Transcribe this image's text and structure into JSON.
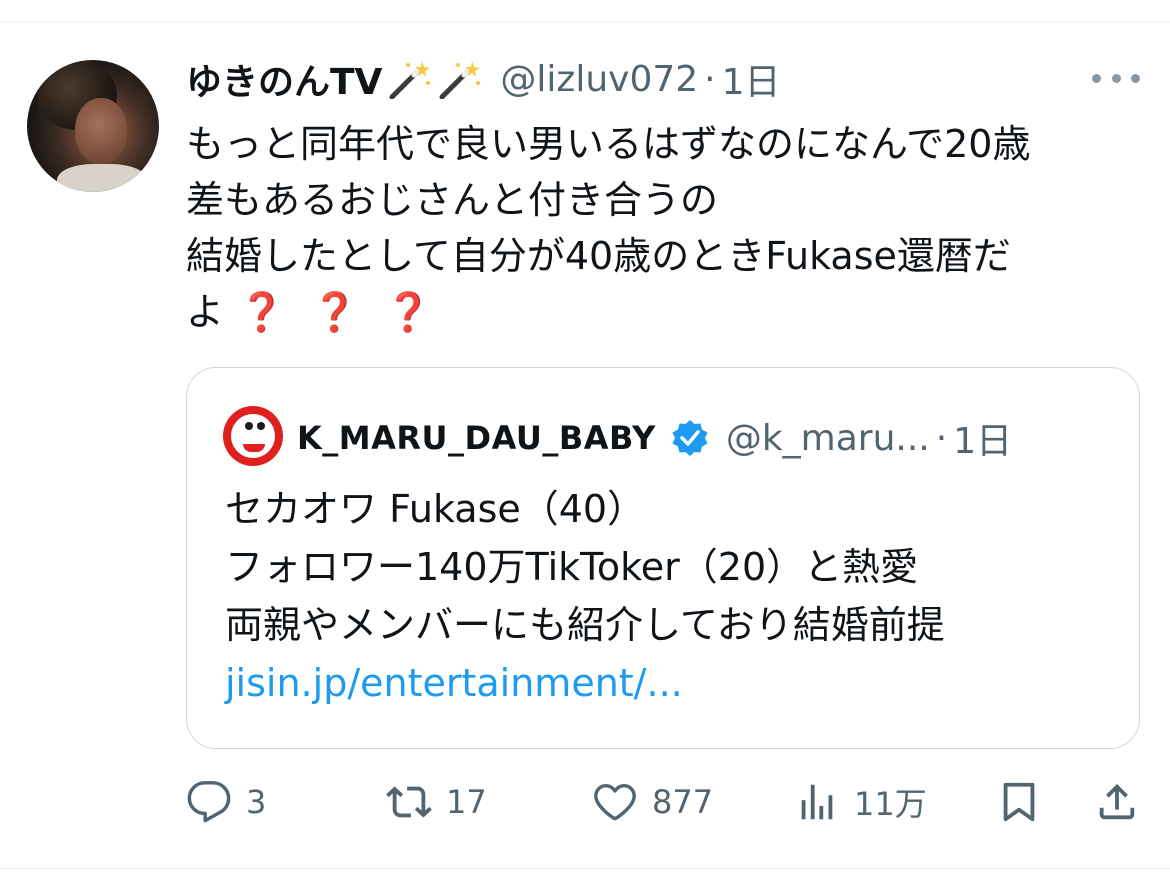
{
  "tweet": {
    "display_name": "ゆきのんTV",
    "name_emoji": [
      "magic-wand",
      "magic-wand"
    ],
    "handle": "@lizluv072",
    "separator": "·",
    "time": "1日",
    "text_lines": [
      "もっと同年代で良い男いるはずなのになんで20歳",
      "差もあるおじさんと付き合うの",
      "結婚したとして自分が40歳のときFukase還暦だ",
      "よ"
    ],
    "question_marks": [
      "❓",
      "❓",
      "❓"
    ]
  },
  "quote": {
    "display_name": "K_MARU_DAU_BABY",
    "verified": true,
    "handle": "@k_maru...",
    "separator": "·",
    "time": "1日",
    "text_lines": [
      "セカオワ Fukase（40）",
      "フォロワー140万TikToker（20）と熱愛",
      "両親やメンバーにも紹介しており結婚前提"
    ],
    "link": "jisin.jp/entertainment/..."
  },
  "actions": {
    "reply": {
      "icon": "reply-icon",
      "count": "3"
    },
    "retweet": {
      "icon": "retweet-icon",
      "count": "17"
    },
    "like": {
      "icon": "heart-icon",
      "count": "877"
    },
    "views": {
      "icon": "analytics-icon",
      "count": "11万"
    },
    "bookmark": {
      "icon": "bookmark-icon"
    },
    "share": {
      "icon": "share-icon"
    }
  },
  "colors": {
    "text": "#0f1419",
    "secondary": "#536471",
    "link": "#1d9bf0",
    "border": "#cfd9de",
    "question_mark": "#d62828",
    "verified": "#1d9bf0"
  }
}
